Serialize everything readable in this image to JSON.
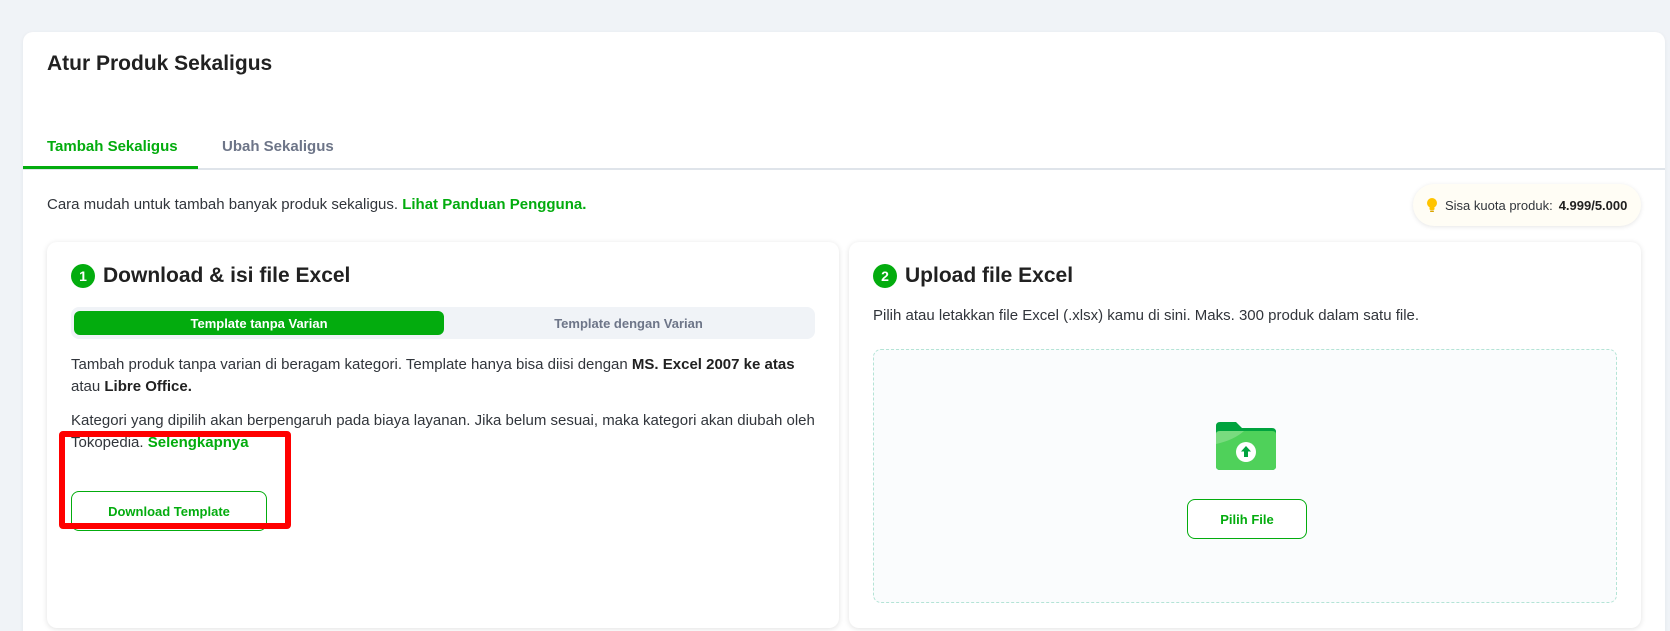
{
  "header": {
    "title": "Atur Produk Sekaligus",
    "tabs": [
      {
        "label": "Tambah Sekaligus",
        "active": true
      },
      {
        "label": "Ubah Sekaligus",
        "active": false
      }
    ]
  },
  "intro": {
    "text": "Cara mudah untuk tambah banyak produk sekaligus. ",
    "link": "Lihat Panduan Pengguna."
  },
  "quota": {
    "label": "Sisa kuota produk: ",
    "value": "4.999/5.000",
    "icon": "lightbulb-icon"
  },
  "step1": {
    "number": "1",
    "title": "Download & isi file Excel",
    "segments": [
      {
        "label": "Template tanpa Varian",
        "selected": true
      },
      {
        "label": "Template dengan Varian",
        "selected": false
      }
    ],
    "desc1": {
      "a": "Tambah produk tanpa varian di beragam kategori. Template hanya bisa diisi dengan ",
      "b": "MS. Excel 2007 ke atas",
      "c": " atau ",
      "d": "Libre Office."
    },
    "desc2": {
      "a": "Kategori yang dipilih akan berpengaruh pada biaya layanan. Jika belum sesuai, maka kategori akan diubah oleh Tokopedia. ",
      "link": "Selengkapnya"
    },
    "download_label": "Download Template"
  },
  "step2": {
    "number": "2",
    "title": "Upload file Excel",
    "description": "Pilih atau letakkan file Excel (.xlsx) kamu di sini. Maks. 300 produk dalam satu file.",
    "pick_label": "Pilih File",
    "icon": "folder-upload-icon"
  },
  "colors": {
    "accent": "#03ac0e",
    "highlight": "#ff0000",
    "background": "#f0f3f7"
  }
}
